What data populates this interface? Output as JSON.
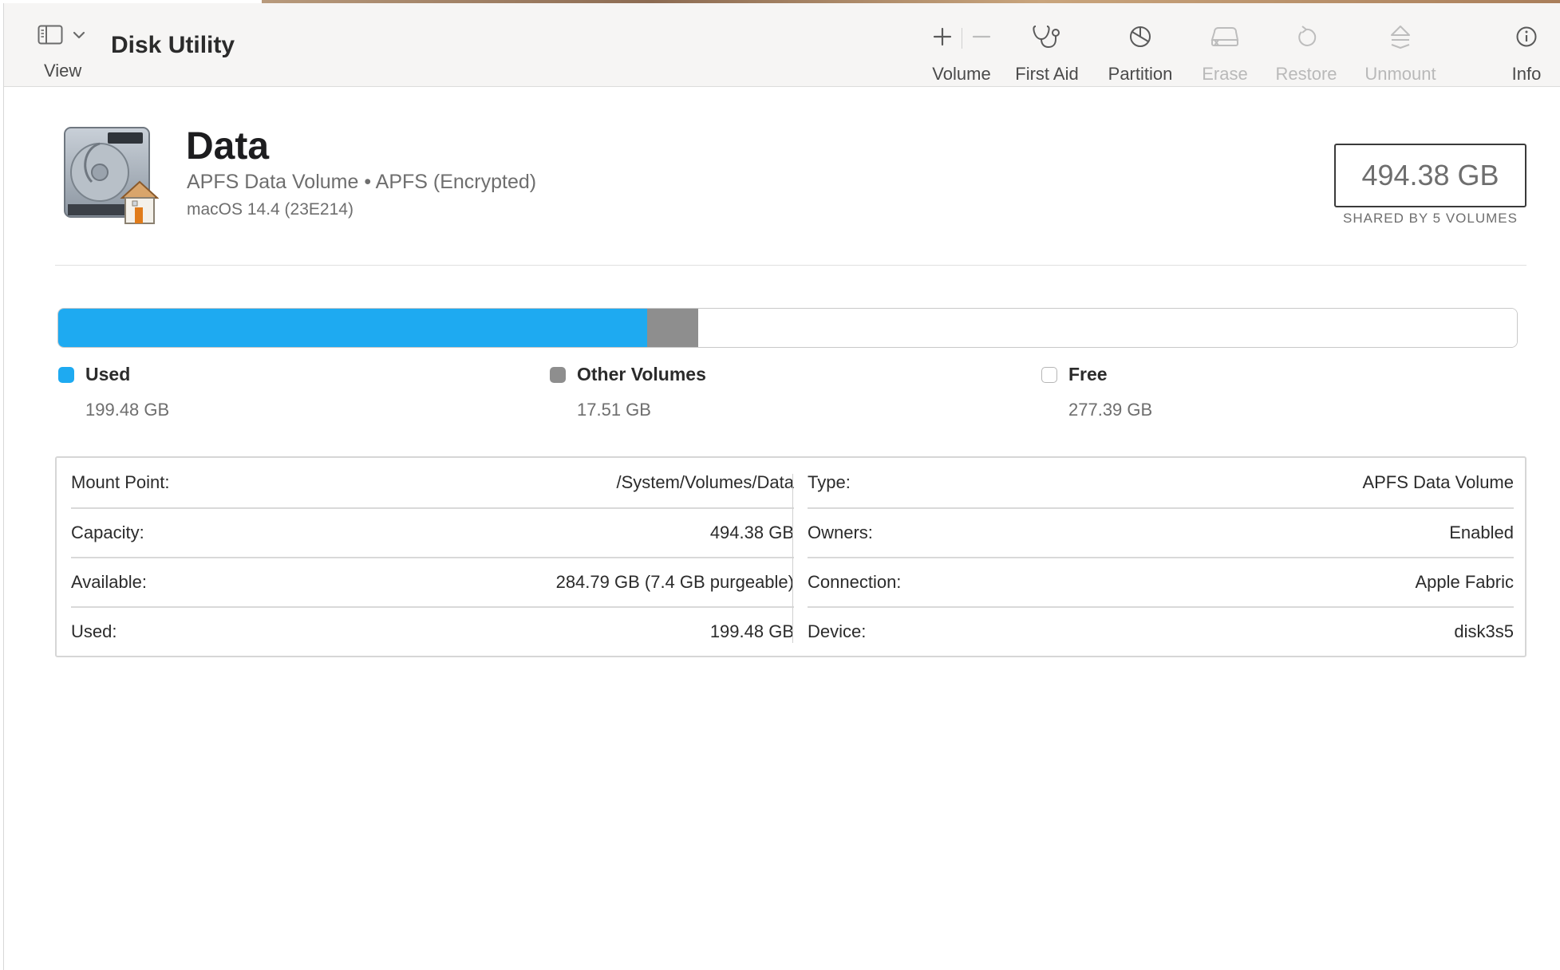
{
  "window": {
    "app_title": "Disk Utility"
  },
  "toolbar": {
    "view_label": "View",
    "volume_label": "Volume",
    "first_aid_label": "First Aid",
    "partition_label": "Partition",
    "erase_label": "Erase",
    "restore_label": "Restore",
    "unmount_label": "Unmount",
    "info_label": "Info"
  },
  "volume": {
    "name": "Data",
    "subtitle": "APFS Data Volume • APFS (Encrypted)",
    "os_version": "macOS 14.4 (23E214)",
    "total_size": "494.38 GB",
    "shared_note": "SHARED BY 5 VOLUMES"
  },
  "usage": {
    "used_fraction": 0.4035,
    "other_fraction": 0.0354,
    "free_fraction": 0.5611,
    "legend": [
      {
        "label": "Used",
        "value": "199.48 GB",
        "color": "#1eaaf1"
      },
      {
        "label": "Other Volumes",
        "value": "17.51 GB",
        "color": "#8e8e8e"
      },
      {
        "label": "Free",
        "value": "277.39 GB",
        "color": "#ffffff"
      }
    ]
  },
  "info": {
    "left": [
      {
        "key": "Mount Point:",
        "value": "/System/Volumes/Data"
      },
      {
        "key": "Capacity:",
        "value": "494.38 GB"
      },
      {
        "key": "Available:",
        "value": "284.79 GB (7.4 GB purgeable)"
      },
      {
        "key": "Used:",
        "value": "199.48 GB"
      }
    ],
    "right": [
      {
        "key": "Type:",
        "value": "APFS Data Volume"
      },
      {
        "key": "Owners:",
        "value": "Enabled"
      },
      {
        "key": "Connection:",
        "value": "Apple Fabric"
      },
      {
        "key": "Device:",
        "value": "disk3s5"
      }
    ]
  },
  "icons": {
    "sidebar": "sidebar-toggle-icon",
    "chevron": "chevron-down-icon",
    "add": "plus-icon",
    "remove": "minus-icon",
    "first_aid": "stethoscope-icon",
    "partition": "pie-chart-icon",
    "erase": "erase-drive-icon",
    "restore": "restore-arrow-icon",
    "unmount": "eject-icon",
    "info": "info-circle-icon",
    "disk": "internal-disk-home-icon"
  }
}
